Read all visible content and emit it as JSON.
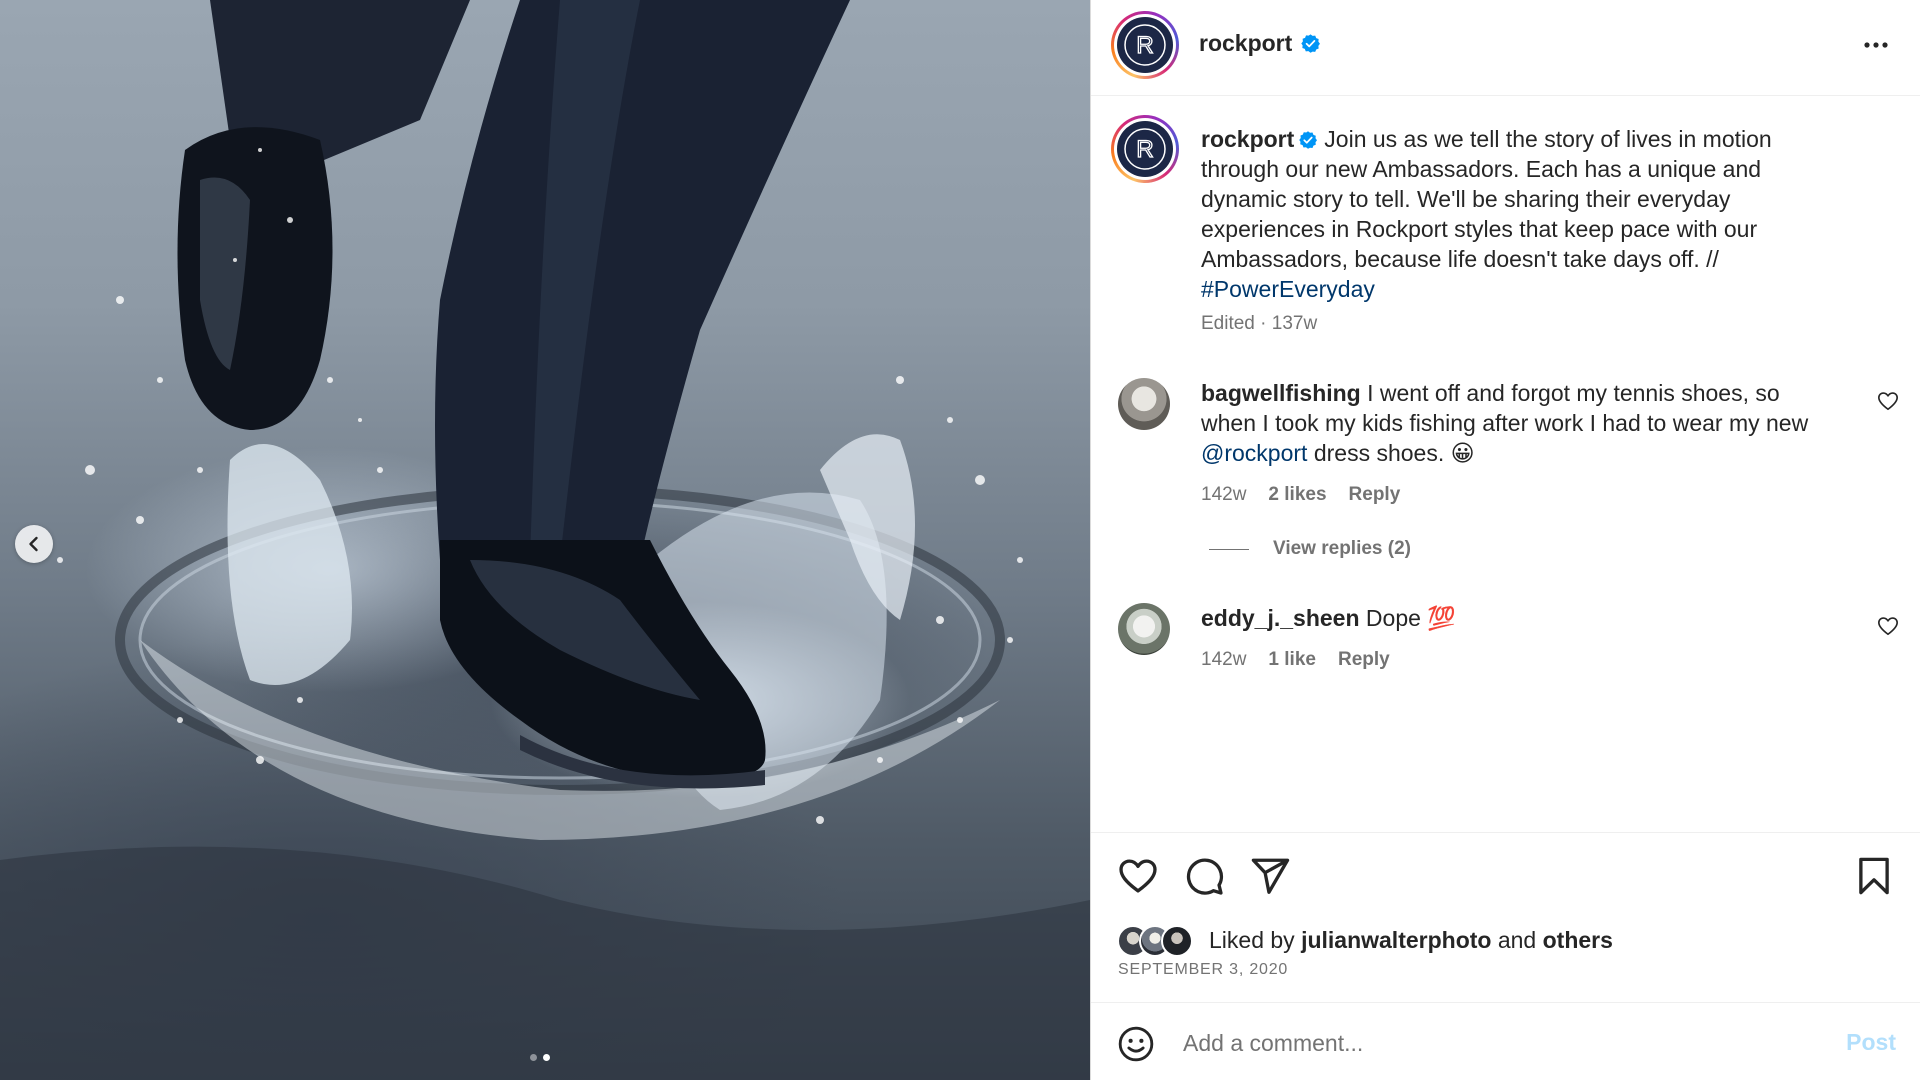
{
  "post": {
    "username": "rockport",
    "verified": true,
    "avatar_letter": "R",
    "caption": "Join us as we tell the story of lives in motion through our new Ambassadors. Each has a unique and dynamic story to tell. We'll be sharing their everyday experiences in Rockport styles that keep pace with our Ambassadors, because life doesn't take days off. //",
    "hashtag": "#PowerEveryday",
    "caption_meta": "Edited · 137w",
    "carousel": {
      "slides": 2,
      "current": 2
    }
  },
  "comments": [
    {
      "user": "bagwellfishing",
      "text_before": "I went off and forgot my tennis shoes, so when I took my kids fishing after work I had to wear my new",
      "mention": "@rockport",
      "text_after": "dress shoes. 😀",
      "age": "142w",
      "likes": "2 likes",
      "reply": "Reply",
      "view_replies": "View replies (2)"
    },
    {
      "user": "eddy_j._sheen",
      "text": "Dope 💯",
      "age": "142w",
      "likes": "1 like",
      "reply": "Reply"
    }
  ],
  "likes_section": {
    "prefix": "Liked by",
    "liker": "julianwalterphoto",
    "and": "and",
    "others": "others",
    "date": "SEPTEMBER 3, 2020"
  },
  "add_comment": {
    "placeholder": "Add a comment...",
    "post_label": "Post"
  },
  "icons": {
    "more": "more-options-icon",
    "like": "heart-icon",
    "comment": "comment-icon",
    "share": "share-icon",
    "save": "bookmark-icon",
    "emoji": "emoji-icon",
    "prev": "chevron-left-icon",
    "verified": "verified-badge-icon"
  },
  "colors": {
    "link": "#00376b",
    "verified": "#0095f6",
    "muted": "#737373",
    "post_disabled": "#b2dffc"
  }
}
